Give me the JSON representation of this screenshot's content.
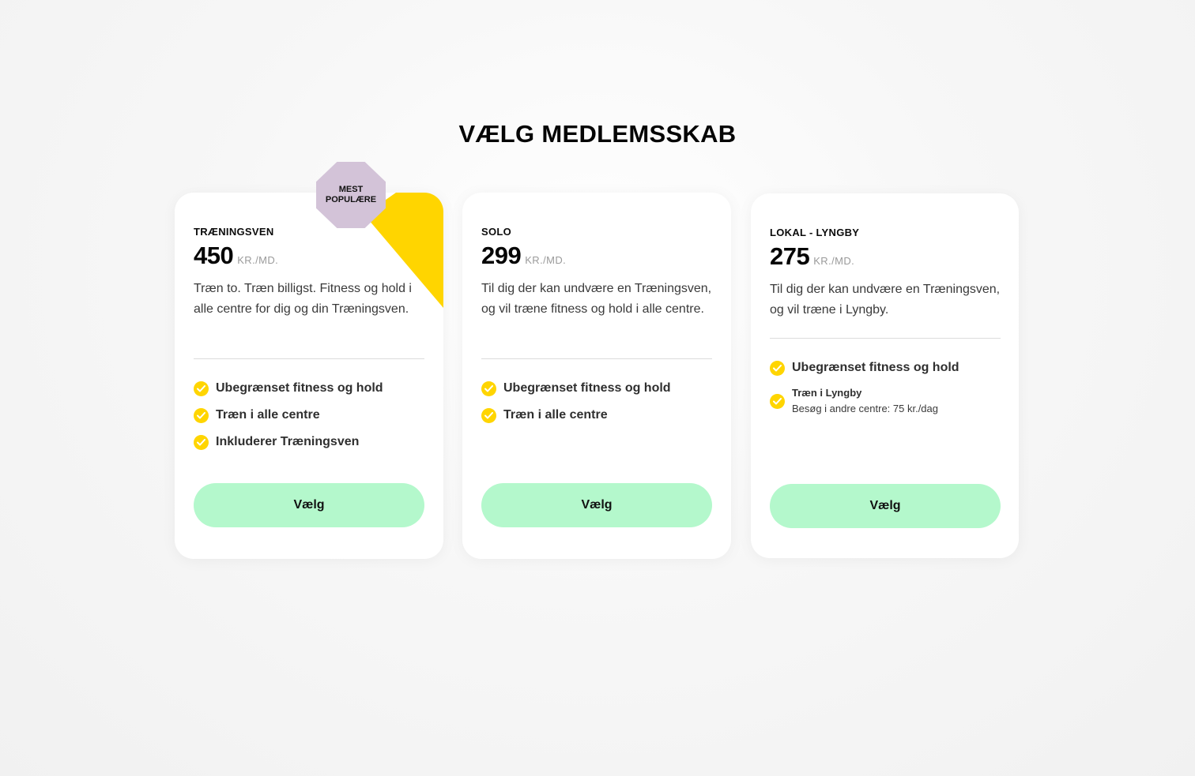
{
  "page": {
    "title": "VÆLG MEDLEMSSKAB"
  },
  "colors": {
    "accent_yellow": "#ffd500",
    "button_green": "#b4f8cc",
    "badge_purple": "#d3c3d8"
  },
  "badge": {
    "line1": "MEST",
    "line2": "POPULÆRE"
  },
  "plans": [
    {
      "name": "TRÆNINGSVEN",
      "price": "450",
      "unit": "KR./MD.",
      "description": "Træn to. Træn billigst. Fitness og hold i alle centre for dig og din Træningsven.",
      "features": [
        "Ubegrænset fitness og hold",
        "Træn i alle centre",
        "Inkluderer Træningsven"
      ],
      "button": "Vælg"
    },
    {
      "name": "SOLO",
      "price": "299",
      "unit": "KR./MD.",
      "description": "Til dig der kan undvære en Træningsven, og vil træne fitness og hold i alle centre.",
      "features": [
        "Ubegrænset fitness og hold",
        "Træn i alle centre"
      ],
      "button": "Vælg"
    },
    {
      "name": "LOKAL - LYNGBY",
      "price": "275",
      "unit": "KR./MD.",
      "description": "Til dig der kan undvære en Træningsven, og vil træne i Lyngby.",
      "features": [
        "Ubegrænset fitness og hold"
      ],
      "feature_detail": {
        "title": "Træn i Lyngby",
        "note": "Besøg i andre centre: 75 kr./dag"
      },
      "button": "Vælg"
    }
  ]
}
